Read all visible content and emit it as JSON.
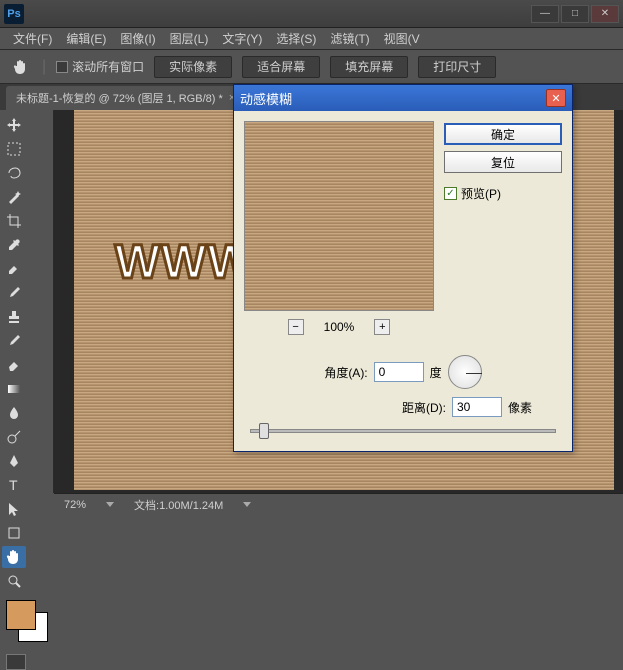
{
  "app": {
    "logo": "Ps"
  },
  "menu": [
    "文件(F)",
    "编辑(E)",
    "图像(I)",
    "图层(L)",
    "文字(Y)",
    "选择(S)",
    "滤镜(T)",
    "视图(V"
  ],
  "options": {
    "scroll_all": "滚动所有窗口",
    "actual_pixels": "实际像素",
    "fit_screen": "适合屏幕",
    "fill_screen": "填充屏幕",
    "print_size": "打印尺寸"
  },
  "doc_tab": {
    "title": "未标题-1-恢复的 @ 72% (图层 1, RGB/8) *",
    "close": "×"
  },
  "swatch": {
    "fg": "#d49a5e",
    "bg": "#ffffff"
  },
  "watermark": "WWW.PSAHZ.COM",
  "status": {
    "zoom": "72%",
    "doc": "文档:1.00M/1.24M"
  },
  "dialog": {
    "title": "动感模糊",
    "ok": "确定",
    "reset": "复位",
    "preview": "预览(P)",
    "zoom_pct": "100%",
    "angle_label": "角度(A):",
    "angle_value": "0",
    "angle_unit": "度",
    "dist_label": "距离(D):",
    "dist_value": "30",
    "dist_unit": "像素"
  }
}
